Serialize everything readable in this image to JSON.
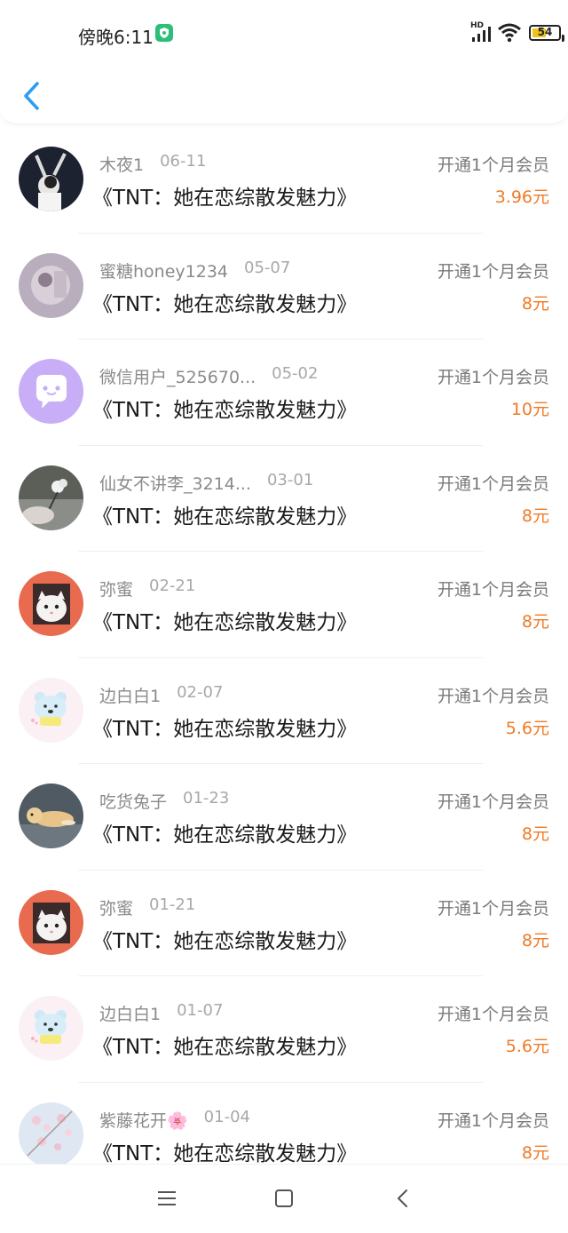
{
  "status_bar": {
    "time": "傍晚6:11",
    "network_label": "HD",
    "battery_level": "54",
    "battery_fraction": 0.54
  },
  "navigation": {
    "back_icon": "chevron-left-icon",
    "accent_color": "#2a9df4"
  },
  "records": [
    {
      "name": "木夜1",
      "date": "06-11",
      "book": "《TNT：她在恋综散发魅力》",
      "action": "开通1个月会员",
      "amount": "3.96元",
      "avatar": "photo-girl-dark"
    },
    {
      "name": "蜜糖honey1234",
      "date": "05-07",
      "book": "《TNT：她在恋综散发魅力》",
      "action": "开通1个月会员",
      "amount": "8元",
      "avatar": "photo-blurred-girl"
    },
    {
      "name": "微信用户_525670...",
      "date": "05-02",
      "book": "《TNT：她在恋综散发魅力》",
      "action": "开通1个月会员",
      "amount": "10元",
      "avatar": "default-chat-avatar"
    },
    {
      "name": "仙女不讲李_3214...",
      "date": "03-01",
      "book": "《TNT：她在恋综散发魅力》",
      "action": "开通1个月会员",
      "amount": "8元",
      "avatar": "photo-flower-hand"
    },
    {
      "name": "弥蜜",
      "date": "02-21",
      "book": "《TNT：她在恋综散发魅力》",
      "action": "开通1个月会员",
      "amount": "8元",
      "avatar": "photo-white-cat"
    },
    {
      "name": "边白白1",
      "date": "02-07",
      "book": "《TNT：她在恋综散发魅力》",
      "action": "开通1个月会员",
      "amount": "5.6元",
      "avatar": "cartoon-bear"
    },
    {
      "name": "吃货兔子",
      "date": "01-23",
      "book": "《TNT：她在恋综散发魅力》",
      "action": "开通1个月会员",
      "amount": "8元",
      "avatar": "photo-plush-dog"
    },
    {
      "name": "弥蜜",
      "date": "01-21",
      "book": "《TNT：她在恋综散发魅力》",
      "action": "开通1个月会员",
      "amount": "8元",
      "avatar": "photo-white-cat"
    },
    {
      "name": "边白白1",
      "date": "01-07",
      "book": "《TNT：她在恋综散发魅力》",
      "action": "开通1个月会员",
      "amount": "5.6元",
      "avatar": "cartoon-bear"
    },
    {
      "name": "紫藤花开🌸",
      "date": "01-04",
      "book": "《TNT：她在恋综散发魅力》",
      "action": "开通1个月会员",
      "amount": "8元",
      "avatar": "photo-blossom"
    }
  ],
  "colors": {
    "amount": "#ef7b26",
    "name": "#8a8a8a",
    "date": "#a8a8a8",
    "title": "#1a1a1a"
  },
  "system_nav": {
    "items": [
      "menu-icon",
      "home-square-icon",
      "back-triangle-icon"
    ]
  }
}
